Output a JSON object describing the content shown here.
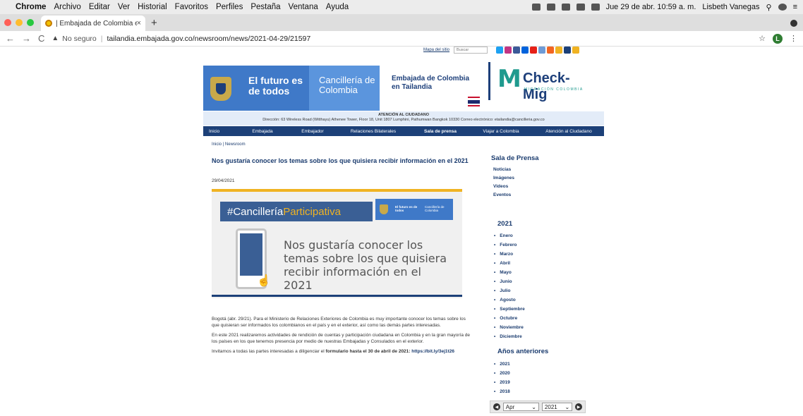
{
  "macbar": {
    "apple": "",
    "app": "Chrome",
    "menus": [
      "Archivo",
      "Editar",
      "Ver",
      "Historial",
      "Favoritos",
      "Perfiles",
      "Pestaña",
      "Ventana",
      "Ayuda"
    ],
    "datetime": "Jue 29 de abr. 10:59 a. m.",
    "user": "Lisbeth Vanegas"
  },
  "tab": {
    "title": "| Embajada de Colombia en Ta",
    "close": "×",
    "new_tab": "+"
  },
  "toolbar": {
    "back": "←",
    "forward": "→",
    "reload": "C",
    "not_secure": "No seguro",
    "url": "tailandia.embajada.gov.co/newsroom/news/2021-04-29/21597",
    "star": "☆",
    "avatar_letter": "L",
    "menu": "⋮"
  },
  "header": {
    "sitemap": "Mapa del sitio",
    "search_placeholder": "Buscar",
    "banner_left": "El futuro es de todos",
    "banner_right": "Cancillería de Colombia",
    "embassy": "Embajada de Colombia en Tailandia",
    "checkmig_title": "Check-Mig",
    "checkmig_sub": "MIGRACIÓN COLOMBIA",
    "atencion_title": "ATENCIÓN AL CIUDADANO",
    "atencion_text": "Dirección: 63 Wireless Road (Witthayu) Athenee Tower, Floor 18, Unit 1807 Lumphini, Pathumwan Bangkok 10330 Correo electrónico: etailandia@cancilleria.gov.co"
  },
  "nav": [
    "Inicio",
    "Embajada",
    "Embajador",
    "Relaciones Bilaterales",
    "Sala de prensa",
    "Viajar a Colombia",
    "Atención al Ciudadano"
  ],
  "breadcrumb": "Inicio | Newsroom",
  "article": {
    "title": "Nos gustaría conocer los temas sobre los que quisiera recibir información en el 2021",
    "date": "29/04/2021",
    "hero_hashtag_a": "#Cancillería",
    "hero_hashtag_b": "Participativa",
    "hero_mini_left": "El futuro es de todos",
    "hero_mini_right": "Cancillería de Colombia",
    "hero_message": "Nos gustaría conocer los temas sobre los que quisiera recibir información en el 2021",
    "p1": "Bogotá (abr. 29/21). Para el Ministerio de Relaciones Exteriores de Colombia es muy importante conocer los temas sobre los que quisieran ser informados los colombianos en el país y en el exterior, así como las demás partes interesadas.",
    "p2": "En este 2021 realizaremos actividades de rendición de cuentas y participación ciudadana en Colombia y en la gran mayoría de los países en los que tenemos presencia por medio de nuestras Embajadas y Consulados en el exterior.",
    "p3_a": "Invitamos a todas las partes interesadas a diligenciar el ",
    "p3_b": "formulario hasta el 30 de abril de 2021: ",
    "p3_link": "https://bit.ly/3ej1t26"
  },
  "sidebar": {
    "title": "Sala de Prensa",
    "links": [
      "Noticias",
      "Imágenes",
      "Videos",
      "Eventos"
    ],
    "year": "2021",
    "months": [
      "Enero",
      "Febrero",
      "Marzo",
      "Abril",
      "Mayo",
      "Junio",
      "Julio",
      "Agosto",
      "Septiembre",
      "Octubre",
      "Noviembre",
      "Diciembre"
    ],
    "previous_title": "Años anteriores",
    "previous_years": [
      "2021",
      "2020",
      "2019",
      "2018"
    ],
    "month_select": "Apr",
    "year_select": "2021"
  },
  "colors": {
    "navy": "#1c4078",
    "banner_blue": "#3f79c8",
    "gold": "#f0b323",
    "teal": "#1f9a8e"
  }
}
